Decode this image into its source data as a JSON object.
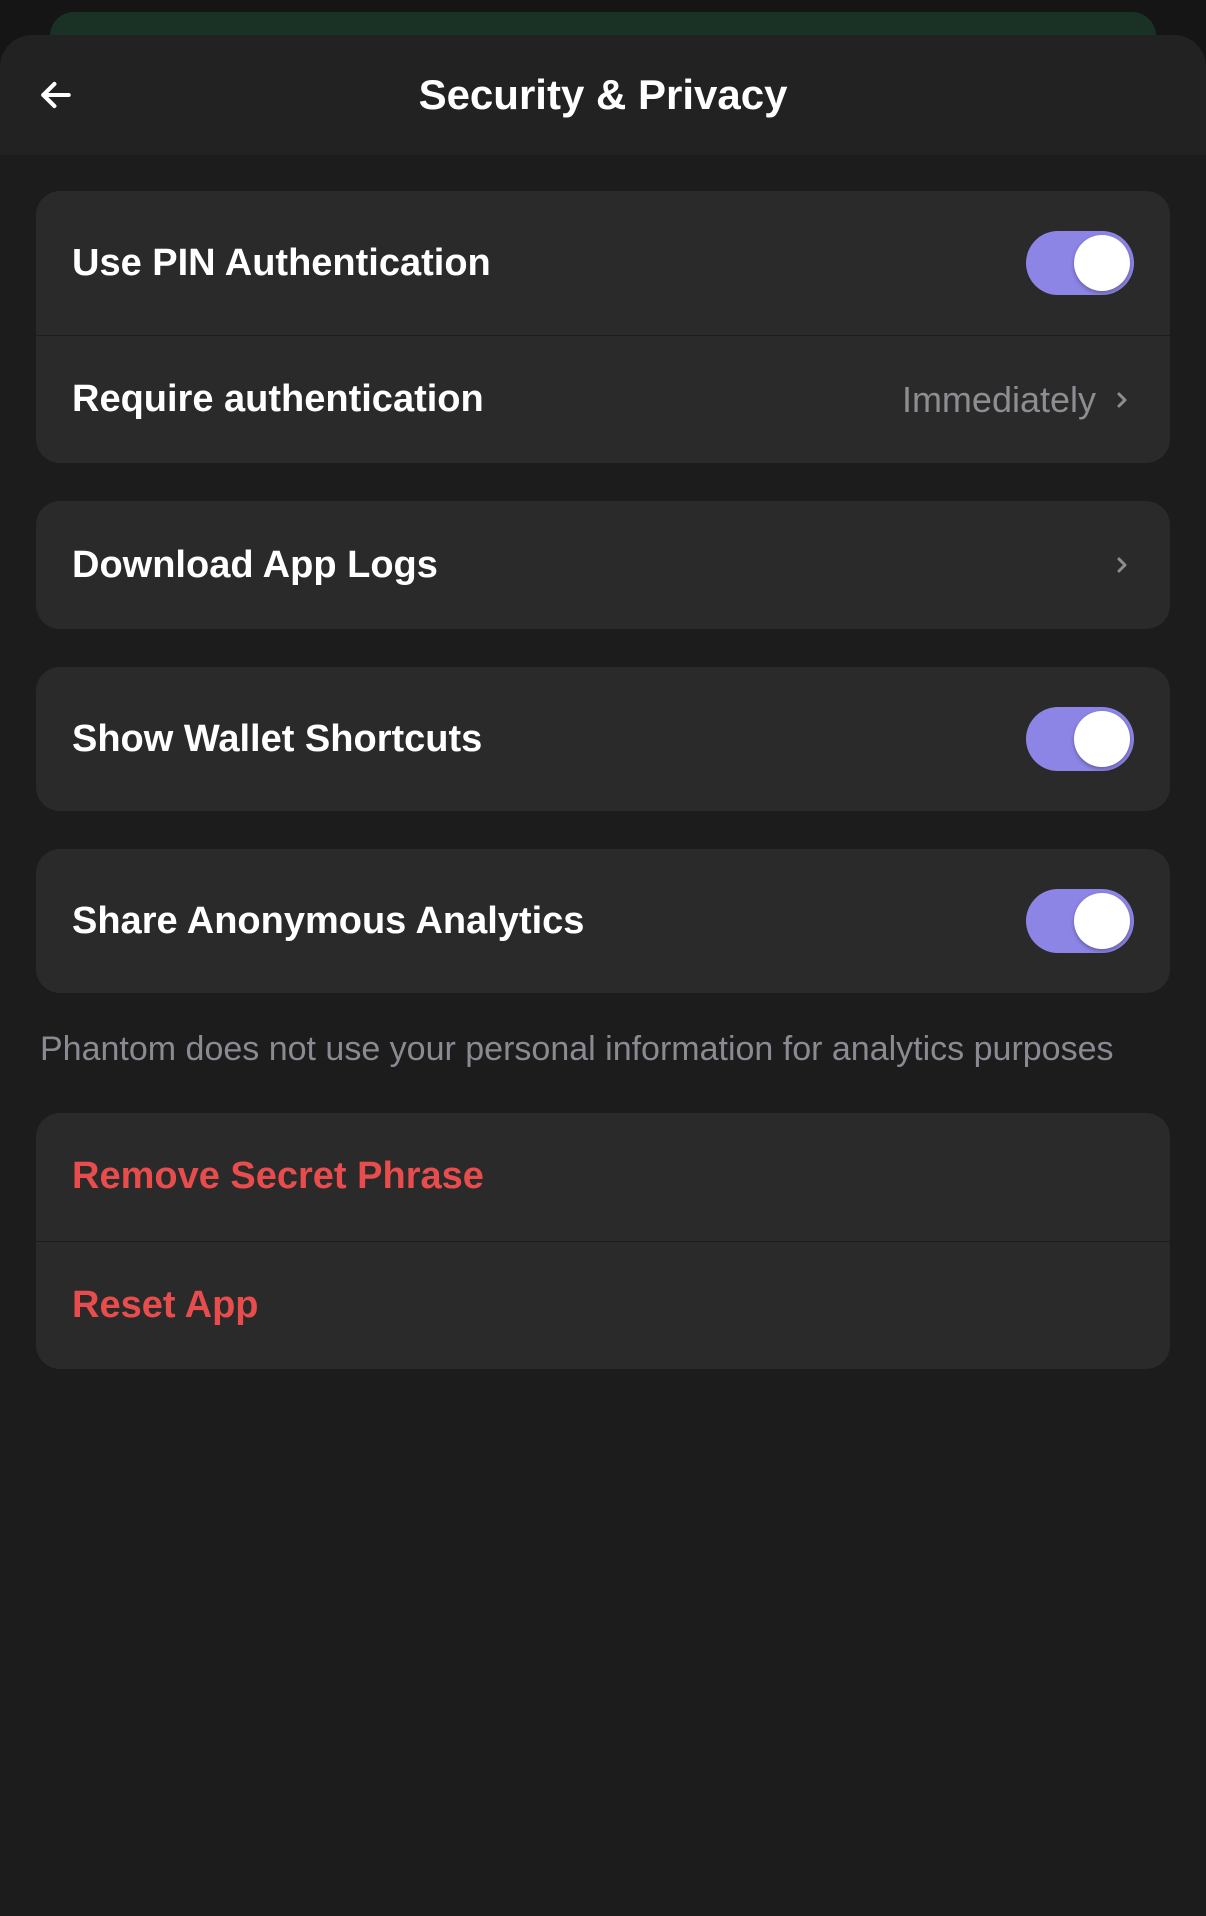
{
  "header": {
    "title": "Security & Privacy"
  },
  "rows": {
    "pin": {
      "label": "Use PIN Authentication",
      "enabled": true
    },
    "require_auth": {
      "label": "Require authentication",
      "value": "Immediately"
    },
    "download_logs": {
      "label": "Download App Logs"
    },
    "wallet_shortcuts": {
      "label": "Show Wallet Shortcuts",
      "enabled": true
    },
    "analytics": {
      "label": "Share Anonymous Analytics",
      "enabled": true
    },
    "remove_phrase": {
      "label": "Remove Secret Phrase"
    },
    "reset_app": {
      "label": "Reset App"
    }
  },
  "analytics_note": "Phantom does not use your personal information for analytics purposes"
}
